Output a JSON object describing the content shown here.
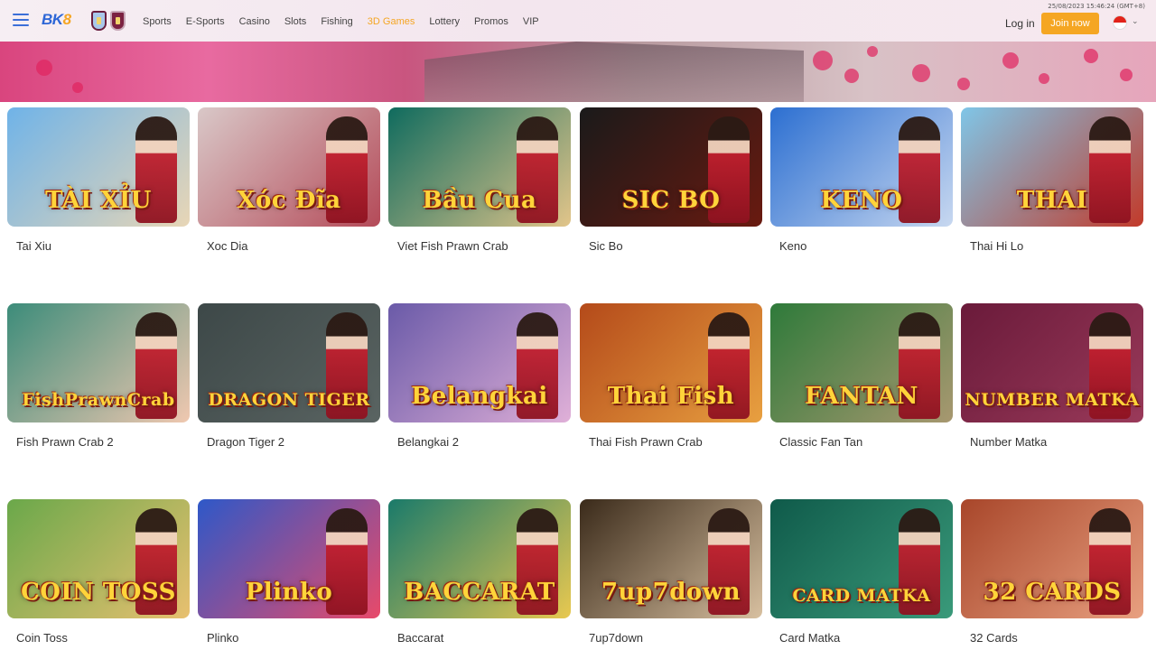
{
  "header": {
    "logo_text": "BK",
    "logo_accent": "8",
    "nav": [
      "Sports",
      "E-Sports",
      "Casino",
      "Slots",
      "Fishing",
      "3D Games",
      "Lottery",
      "Promos",
      "VIP"
    ],
    "active_nav": "3D Games",
    "datetime": "25/08/2023 15:46:24 (GMT+8)",
    "login_label": "Log in",
    "join_label": "Join now",
    "accent_color": "#f5a623"
  },
  "games": [
    {
      "name": "Tai Xiu",
      "art": "TÀI XỈU",
      "bg": [
        "#6fb3e8",
        "#e8d6b6"
      ]
    },
    {
      "name": "Xoc Dia",
      "art": "Xóc Đĩa",
      "bg": [
        "#d9c8c8",
        "#b44a58"
      ]
    },
    {
      "name": "Viet Fish Prawn Crab",
      "art": "Bầu Cua",
      "bg": [
        "#0f6b5e",
        "#e2c58a"
      ]
    },
    {
      "name": "Sic Bo",
      "art": "SIC BO",
      "bg": [
        "#1a1a1a",
        "#6a1a10"
      ]
    },
    {
      "name": "Keno",
      "art": "KENO",
      "bg": [
        "#2c6fd1",
        "#c8d8f0"
      ]
    },
    {
      "name": "Thai Hi Lo",
      "art": "THAI",
      "bg": [
        "#7fc6e8",
        "#c23a2a"
      ]
    },
    {
      "name": "Fish Prawn Crab 2",
      "art": "FishPrawnCrab",
      "bg": [
        "#3c8c7a",
        "#f0c8b0"
      ]
    },
    {
      "name": "Dragon Tiger 2",
      "art": "DRAGON TIGER",
      "bg": [
        "#3d4848",
        "#5a6462"
      ]
    },
    {
      "name": "Belangkai 2",
      "art": "Belangkai",
      "bg": [
        "#6a5aa8",
        "#e0b0d8"
      ]
    },
    {
      "name": "Thai Fish Prawn Crab",
      "art": "Thai Fish",
      "bg": [
        "#b44a1a",
        "#e8a040"
      ]
    },
    {
      "name": "Classic Fan Tan",
      "art": "FANTAN",
      "bg": [
        "#2e7a3a",
        "#a89870"
      ]
    },
    {
      "name": "Number Matka",
      "art": "NUMBER MATKA",
      "bg": [
        "#6a1a3a",
        "#9a3a5a"
      ]
    },
    {
      "name": "Coin Toss",
      "art": "COIN TOSS",
      "bg": [
        "#6aa84a",
        "#e8c070"
      ]
    },
    {
      "name": "Plinko",
      "art": "Plinko",
      "bg": [
        "#2e58c8",
        "#e84a6a"
      ]
    },
    {
      "name": "Baccarat",
      "art": "BACCARAT",
      "bg": [
        "#1a7a6a",
        "#e8c850"
      ]
    },
    {
      "name": "7up7down",
      "art": "7up7down",
      "bg": [
        "#3a2a1a",
        "#d8c0a0"
      ]
    },
    {
      "name": "Card Matka",
      "art": "CARD MATKA",
      "bg": [
        "#0f5a4a",
        "#3a9a7a"
      ]
    },
    {
      "name": "32 Cards",
      "art": "32 CARDS",
      "bg": [
        "#a8462a",
        "#e8a080"
      ]
    }
  ]
}
